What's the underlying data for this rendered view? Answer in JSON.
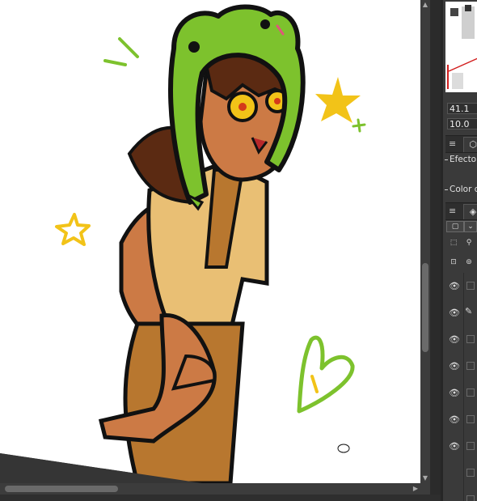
{
  "canvas": {
    "description_icon": "artwork-canvas",
    "background_color": "#ffffff",
    "artwork_colors": {
      "frog_green": "#7dc22d",
      "skin": "#cc7a45",
      "hair": "#5b2a12",
      "shirt": "#e9bf74",
      "overalls": "#b8772f",
      "star_yellow": "#f2c318",
      "outline": "#111111"
    }
  },
  "panel": {
    "navigator_icon": "navigator-thumbnail",
    "zoom_value": "41.1",
    "rotate_value": "10.0",
    "properties_tab_icon": "layer-property-icon",
    "menu_icon": "hamburger-icon",
    "effect_label": "Efecto",
    "color_label": "Color d",
    "layers_tab_icon": "layers-icon",
    "blend_mode_icon": "blend-mode-select",
    "eye_icon": "eye-icon",
    "pencil_icon": "pencil-icon",
    "layers": [
      {
        "visible": true,
        "editing": false
      },
      {
        "visible": true,
        "editing": true
      },
      {
        "visible": true,
        "editing": false
      },
      {
        "visible": true,
        "editing": false
      },
      {
        "visible": true,
        "editing": false
      },
      {
        "visible": true,
        "editing": false
      },
      {
        "visible": true,
        "editing": false
      },
      {
        "visible": false,
        "editing": false
      },
      {
        "visible": false,
        "editing": false
      }
    ]
  }
}
